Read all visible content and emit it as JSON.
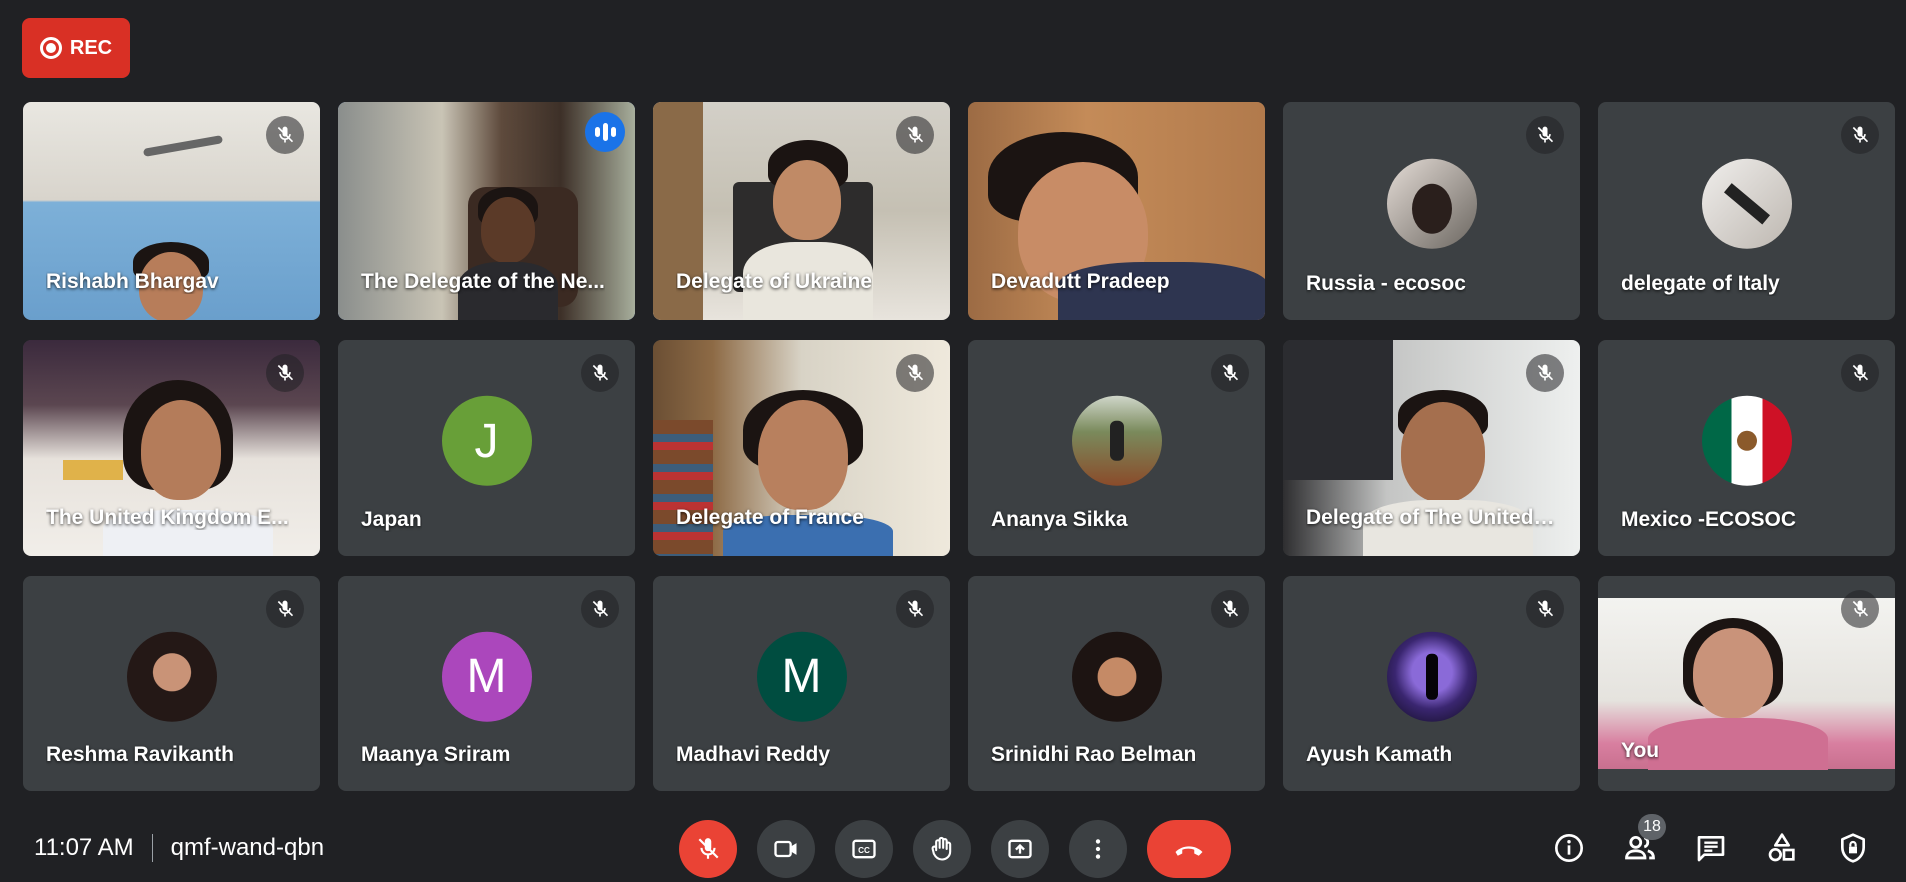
{
  "recording": {
    "label": "REC",
    "color": "#d93025"
  },
  "tiles": [
    {
      "name": "Rishabh Bhargav",
      "kind": "video",
      "muted": true
    },
    {
      "name": "The Delegate of the Ne...",
      "kind": "video",
      "speaking": true
    },
    {
      "name": "Delegate of Ukraine",
      "kind": "video",
      "muted": true
    },
    {
      "name": "Devadutt Pradeep",
      "kind": "video",
      "muted": false
    },
    {
      "name": "Russia - ecosoc",
      "kind": "avatar",
      "avatar": "photo",
      "muted": true
    },
    {
      "name": "delegate of Italy",
      "kind": "avatar",
      "avatar": "photo",
      "muted": true
    },
    {
      "name": "The United Kingdom E...",
      "kind": "video",
      "muted": true
    },
    {
      "name": "Japan",
      "kind": "avatar",
      "initial": "J",
      "avatar_color": "#689f38",
      "muted": true
    },
    {
      "name": "Delegate of France",
      "kind": "video",
      "muted": true
    },
    {
      "name": "Ananya Sikka",
      "kind": "avatar",
      "avatar": "photo",
      "muted": true
    },
    {
      "name": "Delegate of The United ...",
      "kind": "video",
      "muted": true
    },
    {
      "name": "Mexico -ECOSOC",
      "kind": "avatar",
      "avatar": "flag-mexico",
      "muted": true
    },
    {
      "name": "Reshma Ravikanth",
      "kind": "avatar",
      "avatar": "photo",
      "muted": true
    },
    {
      "name": "Maanya Sriram",
      "kind": "avatar",
      "initial": "M",
      "avatar_color": "#ab47bc",
      "muted": true
    },
    {
      "name": "Madhavi Reddy",
      "kind": "avatar",
      "initial": "M",
      "avatar_color": "#004d40",
      "muted": true
    },
    {
      "name": "Srinidhi Rao Belman",
      "kind": "avatar",
      "avatar": "photo",
      "muted": true
    },
    {
      "name": "Ayush Kamath",
      "kind": "avatar",
      "avatar": "photo",
      "muted": true
    },
    {
      "name": "You",
      "kind": "video",
      "muted": true
    }
  ],
  "footer": {
    "time": "11:07 AM",
    "meeting_code": "qmf-wand-qbn",
    "participant_count": "18",
    "controls": [
      "mic-off-icon",
      "camera-icon",
      "captions-icon",
      "raise-hand-icon",
      "present-icon",
      "more-options-icon",
      "end-call-icon"
    ],
    "right_icons": [
      "info-icon",
      "people-icon",
      "chat-icon",
      "activities-icon",
      "host-controls-icon"
    ]
  },
  "colors": {
    "background": "#202124",
    "tile": "#3c4043",
    "accent": "#8ab4f8",
    "danger": "#ea4335"
  }
}
